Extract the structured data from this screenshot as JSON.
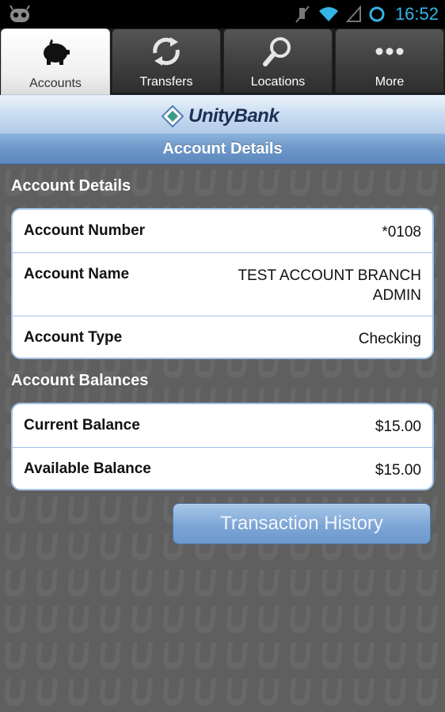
{
  "status_bar": {
    "time": "16:52",
    "icons": [
      "android-logo-icon",
      "mute-icon",
      "wifi-icon",
      "signal-icon",
      "sync-ring-icon"
    ]
  },
  "tabs": [
    {
      "label": "Accounts",
      "icon": "piggy-bank-icon",
      "active": true
    },
    {
      "label": "Transfers",
      "icon": "transfer-arrows-icon",
      "active": false
    },
    {
      "label": "Locations",
      "icon": "magnifier-icon",
      "active": false
    },
    {
      "label": "More",
      "icon": "more-dots-icon",
      "active": false
    }
  ],
  "logo": {
    "text": "UnityBank"
  },
  "header": {
    "title": "Account Details"
  },
  "details": {
    "section_title": "Account Details",
    "rows": [
      {
        "label": "Account Number",
        "value": "*0108"
      },
      {
        "label": "Account Name",
        "value": "TEST ACCOUNT BRANCH ADMIN"
      },
      {
        "label": "Account Type",
        "value": "Checking"
      }
    ]
  },
  "balances": {
    "section_title": "Account Balances",
    "rows": [
      {
        "label": "Current Balance",
        "value": "$15.00"
      },
      {
        "label": "Available Balance",
        "value": "$15.00"
      }
    ]
  },
  "actions": {
    "history_label": "Transaction History"
  },
  "colors": {
    "accent": "#33b5e5",
    "header_blue": "#6c97c8",
    "card_border": "#9fc2e6",
    "brand_navy": "#1e2f55"
  }
}
